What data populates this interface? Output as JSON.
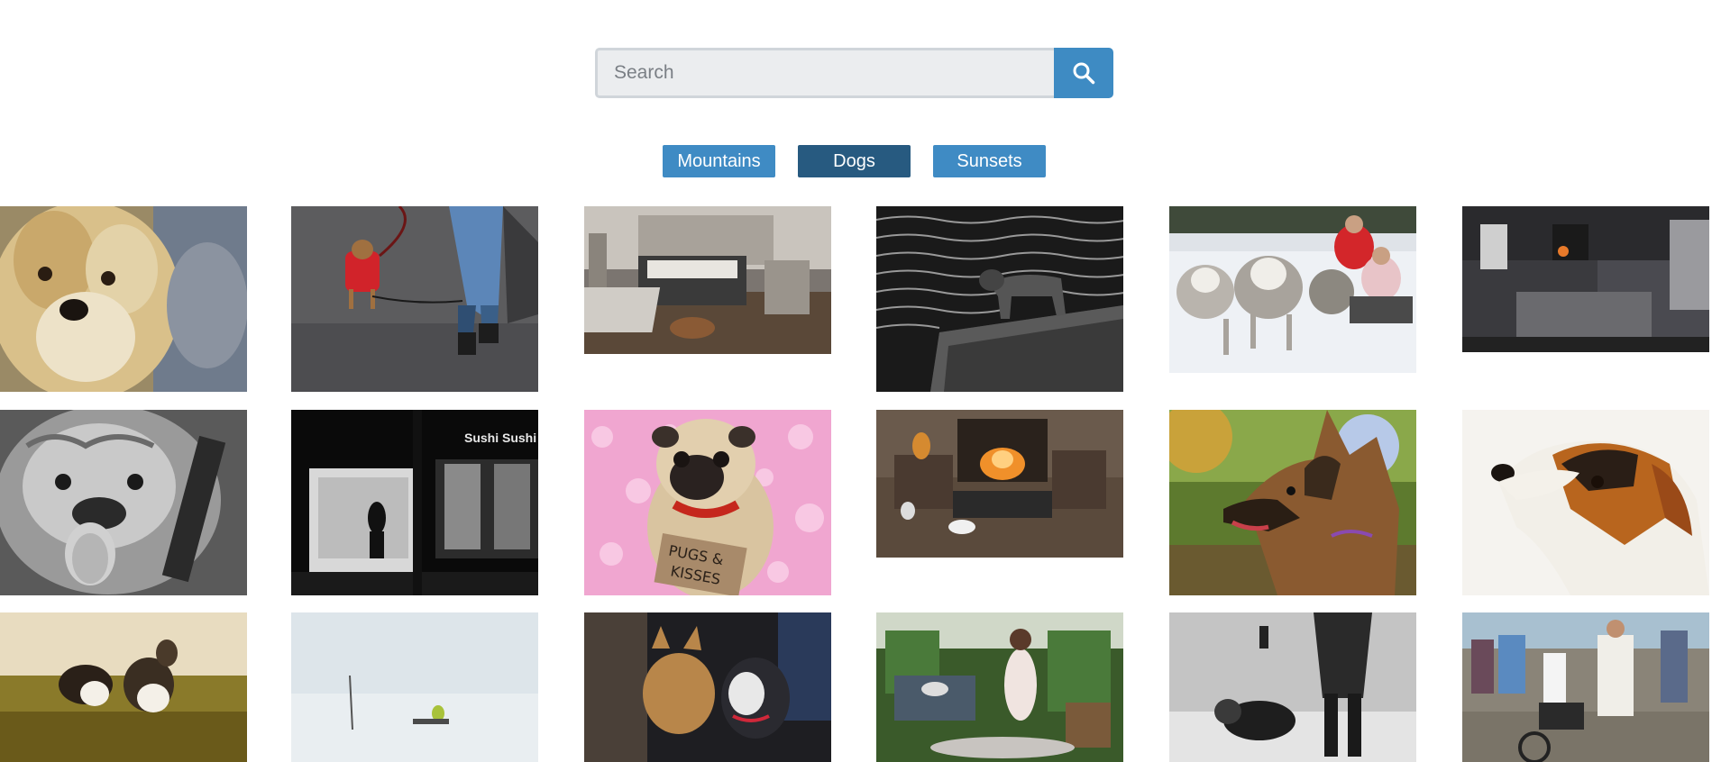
{
  "search": {
    "placeholder": "Search",
    "value": ""
  },
  "tags": [
    {
      "label": "Mountains",
      "active": false
    },
    {
      "label": "Dogs",
      "active": true
    },
    {
      "label": "Sunsets",
      "active": false
    }
  ],
  "colors": {
    "button_blue": "#3f8bc4",
    "active_tag": "#275a80",
    "input_bg": "#ebedef"
  },
  "photos": [
    {
      "subject": "yorkshire-terrier"
    },
    {
      "subject": "dog-in-red-coat-on-leash"
    },
    {
      "subject": "bedroom-with-dog"
    },
    {
      "subject": "dog-on-pier-black-white"
    },
    {
      "subject": "husky-sled-team"
    },
    {
      "subject": "dark-bedroom-interior"
    },
    {
      "subject": "bulldog-black-white"
    },
    {
      "subject": "sushi-shop-night"
    },
    {
      "subject": "pug-pugs-and-kisses"
    },
    {
      "subject": "living-room-fireplace"
    },
    {
      "subject": "german-shepherd"
    },
    {
      "subject": "jack-russell-terrier"
    },
    {
      "subject": "two-puppies-in-grass"
    },
    {
      "subject": "sled-in-snow"
    },
    {
      "subject": "two-dogs-at-door"
    },
    {
      "subject": "garden-patio-woman"
    },
    {
      "subject": "man-walking-dog"
    },
    {
      "subject": "street-crowd-with-bike"
    }
  ],
  "pug_sign": {
    "line1": "PUGS &",
    "line2": "KISSES"
  },
  "sushi_sign": "Sushi Sushi"
}
